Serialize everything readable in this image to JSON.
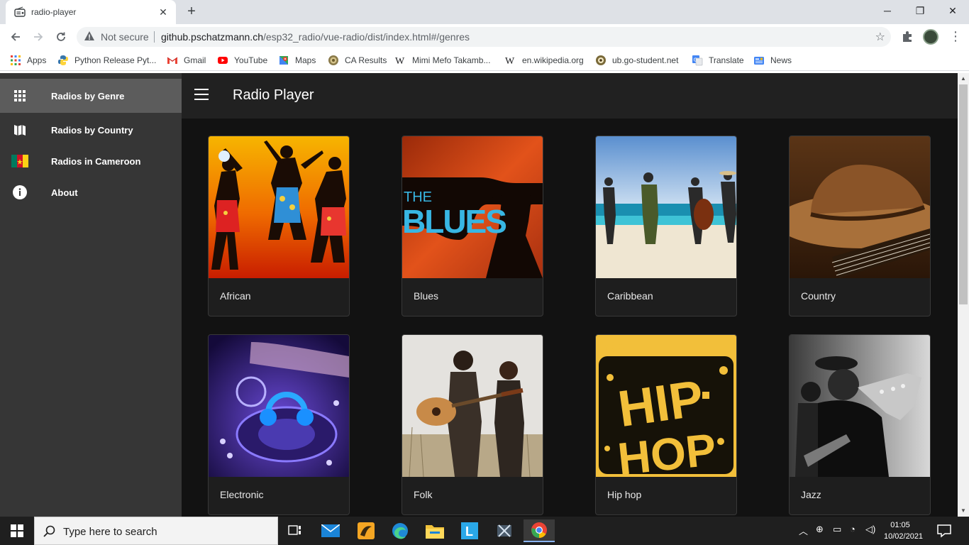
{
  "browser": {
    "tab_title": "radio-player",
    "tab_close": "✕",
    "new_tab": "+",
    "window_controls": {
      "minimize": "─",
      "restore": "❐",
      "close": "✕"
    },
    "security_label": "Not secure",
    "url_host": "github.pschatzmann.ch",
    "url_path": "/esp32_radio/vue-radio/dist/index.html#/genres",
    "bookmarks": [
      {
        "label": "Apps",
        "icon": "apps-grid-icon"
      },
      {
        "label": "Python Release Pyt...",
        "icon": "python-icon"
      },
      {
        "label": "Gmail",
        "icon": "gmail-icon"
      },
      {
        "label": "YouTube",
        "icon": "youtube-icon"
      },
      {
        "label": "Maps",
        "icon": "maps-icon"
      },
      {
        "label": "CA Results",
        "icon": "ca-results-icon"
      },
      {
        "label": "Mimi Mefo Takamb...",
        "icon": "wikipedia-icon"
      },
      {
        "label": "en.wikipedia.org",
        "icon": "wikipedia-icon"
      },
      {
        "label": "ub.go-student.net",
        "icon": "go-student-icon"
      },
      {
        "label": "Translate",
        "icon": "translate-icon"
      },
      {
        "label": "News",
        "icon": "news-icon"
      }
    ]
  },
  "app": {
    "title": "Radio Player",
    "nav": [
      {
        "label": "Radios by Genre",
        "icon": "apps-grid-icon",
        "active": true
      },
      {
        "label": "Radios by Country",
        "icon": "map-icon",
        "active": false
      },
      {
        "label": "Radios in Cameroon",
        "icon": "cameroon-flag-icon",
        "active": false
      },
      {
        "label": "About",
        "icon": "info-icon",
        "active": false
      }
    ],
    "genres": [
      {
        "label": "African"
      },
      {
        "label": "Blues",
        "image_text": "THE BLUES"
      },
      {
        "label": "Caribbean"
      },
      {
        "label": "Country"
      },
      {
        "label": "Electronic"
      },
      {
        "label": "Folk"
      },
      {
        "label": "Hip hop",
        "image_text": "HIP HOP"
      },
      {
        "label": "Jazz"
      }
    ]
  },
  "taskbar": {
    "search_placeholder": "Type here to search",
    "time": "01:05",
    "date": "10/02/2021"
  }
}
